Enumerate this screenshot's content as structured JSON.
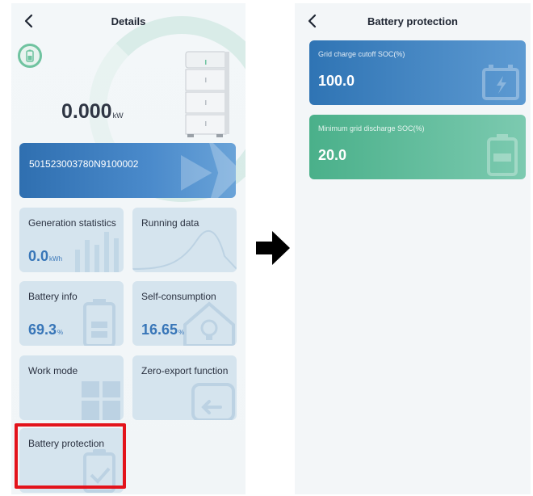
{
  "left": {
    "title": "Details",
    "power_value": "0.000",
    "power_unit": "kW",
    "serial": "501523003780N9100002",
    "tiles": [
      {
        "label": "Generation statistics",
        "value": "0.0",
        "unit": "kWh"
      },
      {
        "label": "Running data",
        "value": "",
        "unit": ""
      },
      {
        "label": "Battery info",
        "value": "69.3",
        "unit": "%"
      },
      {
        "label": "Self-consumption",
        "value": "16.65",
        "unit": "%"
      },
      {
        "label": "Work mode",
        "value": "",
        "unit": ""
      },
      {
        "label": "Zero-export function",
        "value": "",
        "unit": ""
      },
      {
        "label": "Battery protection",
        "value": "",
        "unit": ""
      }
    ]
  },
  "right": {
    "title": "Battery protection",
    "cards": [
      {
        "label": "Grid charge cutoff SOC(%)",
        "value": "100.0"
      },
      {
        "label": "Minimum grid discharge SOC(%)",
        "value": "20.0"
      }
    ]
  },
  "icons": {
    "back": "chevron-left-icon",
    "transition": "arrow-right-icon"
  },
  "colors": {
    "highlight": "#e3131b",
    "blue_card": "#2f74b4",
    "green_card": "#4ab08a",
    "value_blue": "#3876b8"
  }
}
